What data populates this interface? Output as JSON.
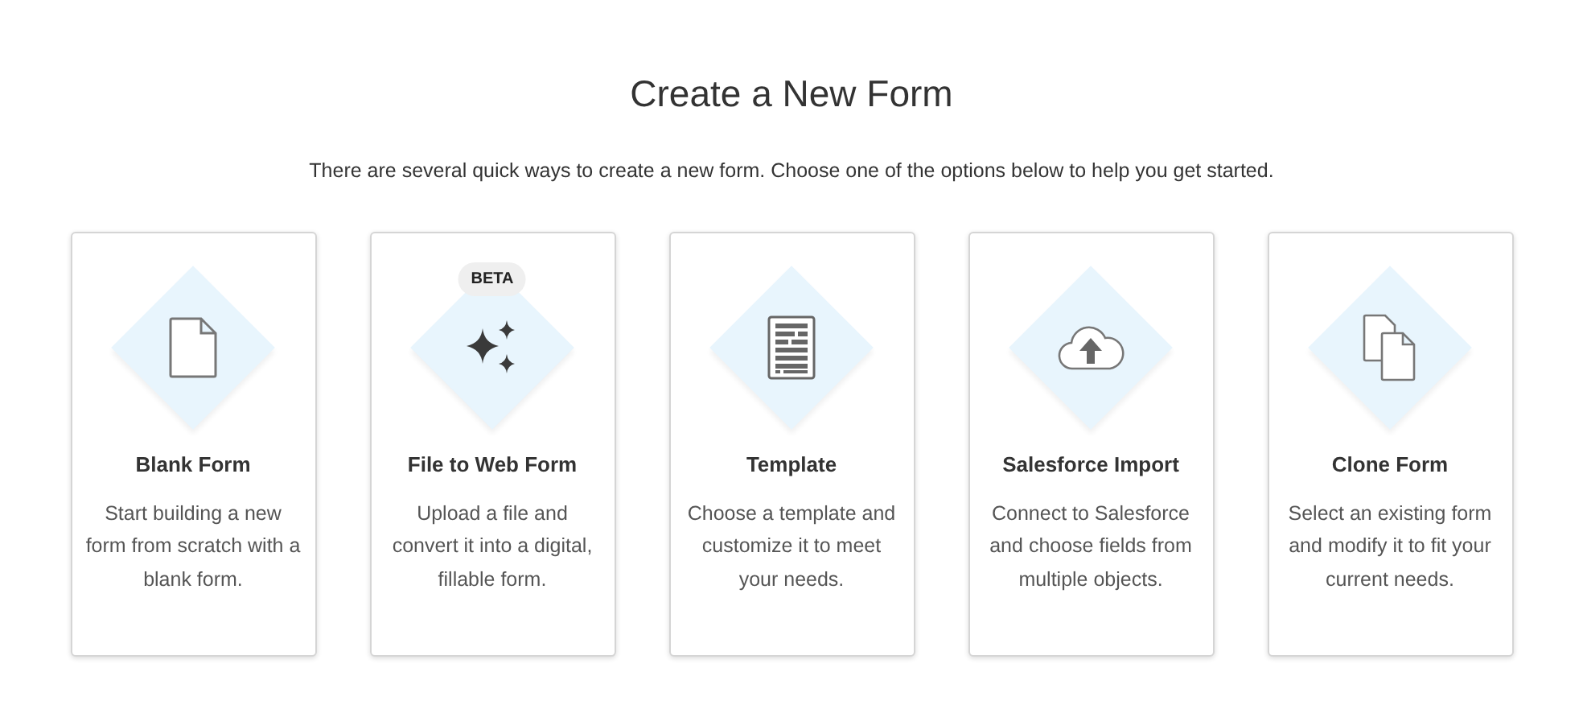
{
  "title": "Create a New Form",
  "subtitle": "There are several quick ways to create a new form. Choose one of the options below to help you get started.",
  "options": [
    {
      "kind": "blank",
      "title": "Blank Form",
      "description": "Start building a new form from scratch with a blank form."
    },
    {
      "kind": "sparkles",
      "badge": "BETA",
      "title": "File to Web Form",
      "description": "Upload a file and convert it into a digital, fillable form."
    },
    {
      "kind": "template",
      "title": "Template",
      "description": "Choose a template and customize it to meet your needs."
    },
    {
      "kind": "upload",
      "title": "Salesforce Import",
      "description": "Connect to Salesforce and choose fields from multiple objects."
    },
    {
      "kind": "clone",
      "title": "Clone Form",
      "description": "Select an existing form and modify it to fit your current needs."
    }
  ]
}
